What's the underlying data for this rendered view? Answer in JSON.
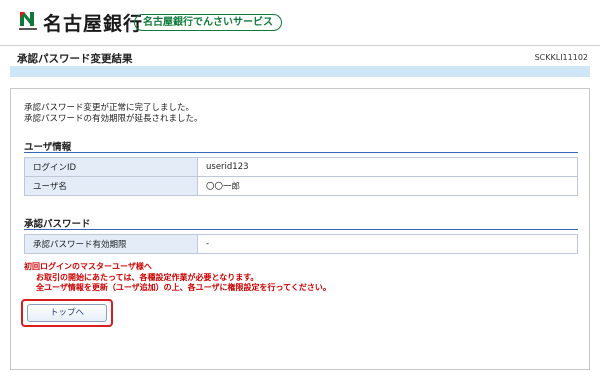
{
  "header": {
    "bank_name": "名古屋銀行",
    "service_name": "名古屋銀行でんさいサービス"
  },
  "page": {
    "title": "承認パスワード変更結果",
    "screen_id": "SCKKLI11102"
  },
  "message": {
    "line1": "承認パスワード変更が正常に完了しました。",
    "line2": "承認パスワードの有効期限が延長されました。"
  },
  "user_info": {
    "section_title": "ユーザ情報",
    "rows": [
      {
        "label": "ログインID",
        "value": "userid123"
      },
      {
        "label": "ユーザ名",
        "value": "〇〇一郎"
      }
    ]
  },
  "approval_password": {
    "section_title": "承認パスワード",
    "rows": [
      {
        "label": "承認パスワード有効期限",
        "value": "-"
      }
    ]
  },
  "notice": {
    "line1": "初回ログインのマスターユーザ様へ",
    "line2": "お取引の開始にあたっては、各種設定作業が必要となります。",
    "line3": "全ユーザ情報を更新（ユーザ追加）の上、各ユーザに権限設定を行ってください。"
  },
  "buttons": {
    "top_label": "トップへ"
  },
  "colors": {
    "brand_green": "#0d7a3a",
    "band_blue": "#cfe6f7",
    "section_line": "#3a68b8",
    "notice_red": "#cc0000",
    "highlight_red": "#d81e1e"
  }
}
